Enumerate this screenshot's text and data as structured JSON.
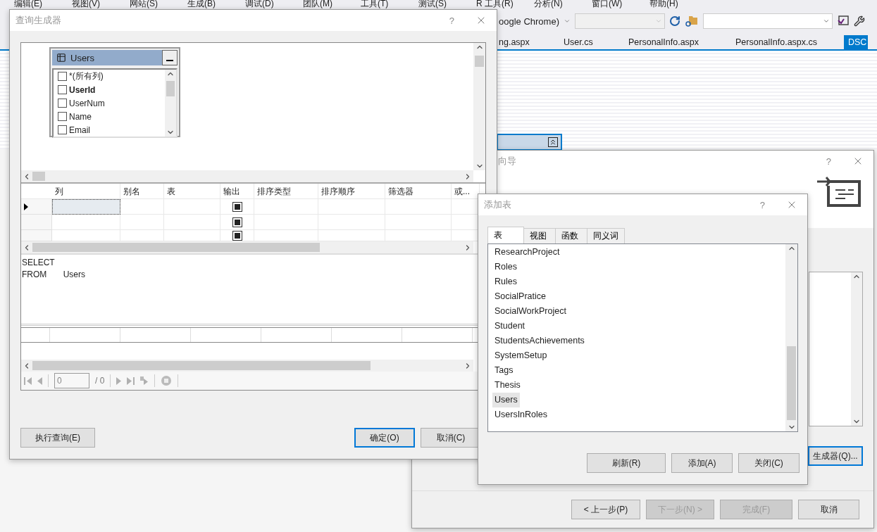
{
  "ide": {
    "menu": [
      "编辑(E)",
      "视图(V)",
      "网站(S)",
      "生成(B)",
      "调试(D)",
      "团队(M)",
      "工具(T)",
      "测试(S)",
      "R 工具(R)",
      "分析(N)",
      "窗口(W)",
      "帮助(H)"
    ],
    "toolbar": {
      "browser_label": "oogle Chrome)"
    },
    "doc_tabs": [
      {
        "label": "ng.aspx",
        "selected": false
      },
      {
        "label": "User.cs",
        "selected": false
      },
      {
        "label": "PersonalInfo.aspx",
        "selected": false
      },
      {
        "label": "PersonalInfo.aspx.cs",
        "selected": false
      },
      {
        "label": "DSC",
        "selected": true
      }
    ]
  },
  "query_builder": {
    "title": "查询生成器",
    "help": "?",
    "table_box": {
      "name": "Users",
      "columns": [
        {
          "name": "*(所有列)",
          "checked": false,
          "key": false
        },
        {
          "name": "UserId",
          "checked": false,
          "key": true
        },
        {
          "name": "UserNum",
          "checked": false,
          "key": false
        },
        {
          "name": "Name",
          "checked": false,
          "key": false
        },
        {
          "name": "Email",
          "checked": false,
          "key": false
        }
      ]
    },
    "grid": {
      "columns": [
        "列",
        "别名",
        "表",
        "输出",
        "排序类型",
        "排序顺序",
        "筛选器",
        "或..."
      ],
      "rows": [
        {
          "output": true,
          "selected": true
        },
        {
          "output": true,
          "selected": false
        },
        {
          "output": true,
          "selected": false
        }
      ]
    },
    "sql": [
      {
        "keyword": "SELECT"
      },
      {
        "keyword": "FROM",
        "value": "Users"
      }
    ],
    "results": {
      "page": "0",
      "total": "/ 0"
    },
    "buttons": [
      {
        "label": "执行查询(E)",
        "default": false
      },
      {
        "label": "确定(O)",
        "default": true
      },
      {
        "label": "取消(C)",
        "default": false
      }
    ]
  },
  "wizard": {
    "title": "向导",
    "help": "?",
    "builder_button": "生成器(Q)...",
    "buttons": [
      {
        "label": "< 上一步(P)",
        "disabled": false
      },
      {
        "label": "下一步(N) >",
        "disabled": true
      },
      {
        "label": "完成(F)",
        "disabled": true
      },
      {
        "label": "取消",
        "disabled": false
      }
    ]
  },
  "add_table": {
    "title": "添加表",
    "help": "?",
    "tabs": [
      {
        "label": "表",
        "selected": true
      },
      {
        "label": "视图",
        "selected": false
      },
      {
        "label": "函数",
        "selected": false
      },
      {
        "label": "同义词",
        "selected": false
      }
    ],
    "items": [
      {
        "label": "ResearchProject",
        "selected": false
      },
      {
        "label": "Roles",
        "selected": false
      },
      {
        "label": "Rules",
        "selected": false
      },
      {
        "label": "SocialPratice",
        "selected": false
      },
      {
        "label": "SocialWorkProject",
        "selected": false
      },
      {
        "label": "Student",
        "selected": false
      },
      {
        "label": "StudentsAchievements",
        "selected": false
      },
      {
        "label": "SystemSetup",
        "selected": false
      },
      {
        "label": "Tags",
        "selected": false
      },
      {
        "label": "Thesis",
        "selected": false
      },
      {
        "label": "Users",
        "selected": true
      },
      {
        "label": "UsersInRoles",
        "selected": false
      }
    ],
    "buttons": [
      "刷新(R)",
      "添加(A)",
      "关闭(C)"
    ]
  }
}
